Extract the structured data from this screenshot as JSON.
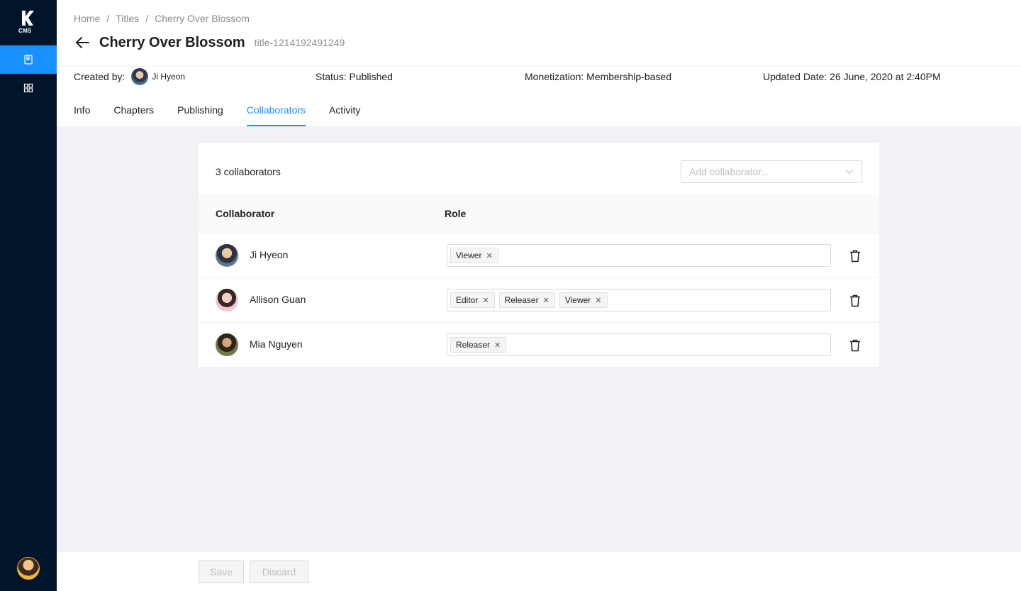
{
  "sidebar": {
    "logo_text": "CMS",
    "items": [
      {
        "icon": "book-icon",
        "active": true
      },
      {
        "icon": "grid-icon",
        "active": false
      }
    ]
  },
  "breadcrumb": [
    "Home",
    "Titles",
    "Cherry Over Blossom"
  ],
  "breadcrumb_separator": "/",
  "title": "Cherry Over Blossom",
  "title_id": "title-1214192491249",
  "meta": {
    "created_by_label": "Created by:",
    "created_by_name": "Ji Hyeon",
    "status": "Status: Published",
    "monetization": "Monetization: Membership-based",
    "updated": "Updated Date: 26 June, 2020 at 2:40PM"
  },
  "tabs": [
    "Info",
    "Chapters",
    "Publishing",
    "Collaborators",
    "Activity"
  ],
  "active_tab": "Collaborators",
  "collaborators": {
    "count_text": "3 collaborators",
    "add_placeholder": "Add collaborator...",
    "headers": {
      "collaborator": "Collaborator",
      "role": "Role"
    },
    "rows": [
      {
        "name": "Ji Hyeon",
        "roles": [
          "Viewer"
        ]
      },
      {
        "name": "Allison Guan",
        "roles": [
          "Editor",
          "Releaser",
          "Viewer"
        ]
      },
      {
        "name": "Mia Nguyen",
        "roles": [
          "Releaser"
        ]
      }
    ]
  },
  "footer": {
    "save_label": "Save",
    "discard_label": "Discard"
  },
  "colors": {
    "accent": "#1890ff",
    "sidebar_bg": "#001529"
  }
}
